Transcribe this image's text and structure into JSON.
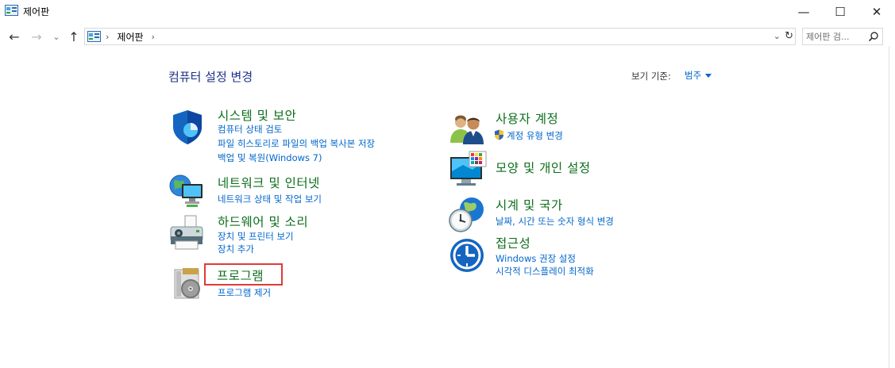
{
  "window": {
    "title": "제어판",
    "controls": {
      "minimize": "—",
      "maximize": "☐",
      "close": "✕"
    }
  },
  "nav": {
    "back": "←",
    "forward": "→",
    "recent": "⌄",
    "up": "↑"
  },
  "address": {
    "crumb": "제어판",
    "separator": "›",
    "dropdown": "⌄",
    "refresh": "↻"
  },
  "search": {
    "placeholder": "제어판 검..."
  },
  "main": {
    "heading": "컴퓨터 설정 변경",
    "view_by_label": "보기 기준:",
    "view_by_value": "범주"
  },
  "categories": {
    "system": {
      "title": "시스템 및 보안",
      "links": [
        "컴퓨터 상태 검토",
        "파일 히스토리로 파일의 백업 복사본 저장",
        "백업 및 복원(Windows 7)"
      ]
    },
    "network": {
      "title": "네트워크 및 인터넷",
      "links": [
        "네트워크 상태 및 작업 보기"
      ]
    },
    "hardware": {
      "title": "하드웨어 및 소리",
      "links": [
        "장치 및 프린터 보기",
        "장치 추가"
      ]
    },
    "programs": {
      "title": "프로그램",
      "links": [
        "프로그램 제거"
      ]
    },
    "users": {
      "title": "사용자 계정",
      "links": [
        "계정 유형 변경"
      ]
    },
    "appearance": {
      "title": "모양 및 개인 설정",
      "links": []
    },
    "clock": {
      "title": "시계 및 국가",
      "links": [
        "날짜, 시간 또는 숫자 형식 변경"
      ]
    },
    "access": {
      "title": "접근성",
      "links": [
        "Windows 권장 설정",
        "시각적 디스플레이 최적화"
      ]
    }
  },
  "icons": {
    "window": "control-panel-icon",
    "system": "shield-icon",
    "network": "globe-network-icon",
    "hardware": "printer-icon",
    "programs": "programs-disc-icon",
    "users": "users-icon",
    "appearance": "monitor-palette-icon",
    "clock": "clock-globe-icon",
    "access": "accessibility-icon",
    "uac": "uac-shield-icon",
    "search": "search-icon"
  },
  "colors": {
    "category_title": "#0b6e1b",
    "link": "#0066cc",
    "heading": "#1e3287",
    "highlight": "#e03a3a"
  }
}
